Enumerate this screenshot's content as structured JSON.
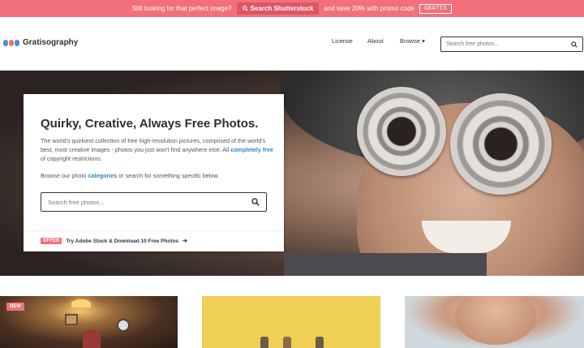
{
  "promo": {
    "text_before": "Still looking for that perfect image?",
    "button_label": "Search Shutterstock",
    "text_after": "and save 20% with promo code",
    "code": "GRATIS"
  },
  "header": {
    "logo_text": "Gratisography",
    "logo_colors": [
      "#4a90d9",
      "#f2707b",
      "#4a90d9"
    ],
    "nav": [
      "License",
      "About",
      "Browse"
    ],
    "search_placeholder": "Search free photos..."
  },
  "hero": {
    "title": "Quirky, Creative, Always Free Photos.",
    "description": "The world's quirkiest collection of free high-resolution pictures, comprised of the world's best, most creative images - photos you just won't find anywhere else. All",
    "description_link": "completely free",
    "description_end": "of copyright restrictions.",
    "browse_before": "Browse our photo",
    "browse_link": "categories",
    "browse_after": "or search for something specific below.",
    "search_placeholder": "Search free photos...",
    "offer_tag": "OFFER",
    "offer_text": "Try Adobe Stock & Download 10 Free Photos"
  },
  "thumbnails": {
    "badge": "NEW"
  },
  "colors": {
    "brand": "#f2707b",
    "link": "#2b8cc4"
  }
}
